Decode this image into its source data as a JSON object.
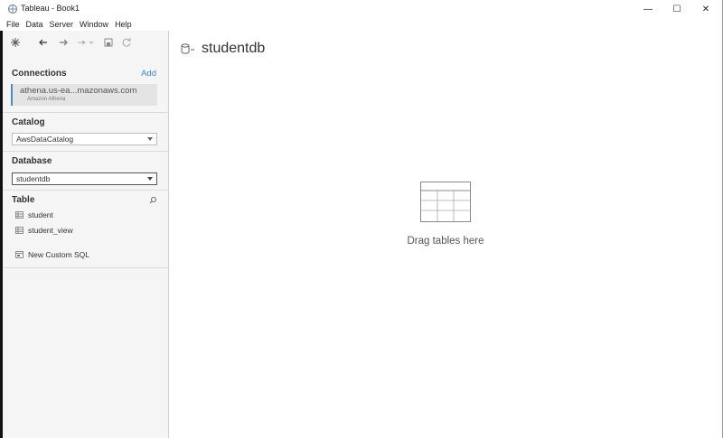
{
  "window": {
    "title": "Tableau - Book1",
    "controls": {
      "minimize": "—",
      "maximize": "☐",
      "close": "✕"
    }
  },
  "menu": [
    "File",
    "Data",
    "Server",
    "Window",
    "Help"
  ],
  "toolbar": {
    "icons": [
      "tableau-home-icon",
      "back-arrow-icon",
      "forward-arrow-icon",
      "datasource-icon",
      "save-icon",
      "refresh-icon"
    ]
  },
  "connections": {
    "title": "Connections",
    "add_label": "Add",
    "item": {
      "name": "athena.us-ea...mazonaws.com",
      "type": "Amazon Athena"
    }
  },
  "catalog": {
    "title": "Catalog",
    "value": "AwsDataCatalog"
  },
  "database": {
    "title": "Database",
    "value": "studentdb"
  },
  "table": {
    "title": "Table",
    "items": [
      "student",
      "student_view"
    ],
    "custom_sql": "New Custom SQL"
  },
  "canvas": {
    "datasource_name": "studentdb",
    "drop_hint": "Drag tables here"
  },
  "colors": {
    "accent": "#4a8cc4",
    "link": "#3b8bc5",
    "panel_bg": "#f5f5f5"
  }
}
